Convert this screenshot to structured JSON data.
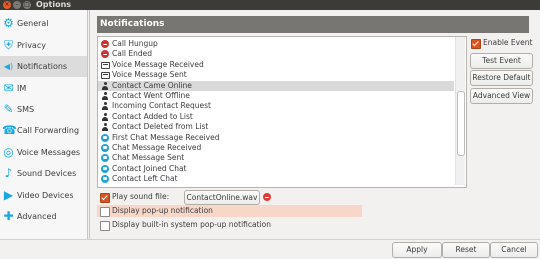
{
  "window": {
    "title": "Options",
    "close_glyph": "×",
    "min_glyph": "–",
    "max_glyph": "□"
  },
  "sidebar": {
    "items": [
      {
        "label": "General",
        "icon": "gear-icon",
        "glyph": "⚙"
      },
      {
        "label": "Privacy",
        "icon": "shield-icon",
        "glyph": "⛨"
      },
      {
        "label": "Notifications",
        "icon": "speaker-icon",
        "glyph": "◀)",
        "selected": true
      },
      {
        "label": "IM",
        "icon": "chat-icon",
        "glyph": "✉"
      },
      {
        "label": "SMS",
        "icon": "sms-icon",
        "glyph": "✎"
      },
      {
        "label": "Call Forwarding",
        "icon": "call-forward-icon",
        "glyph": "☎"
      },
      {
        "label": "Voice Messages",
        "icon": "voicemail-icon",
        "glyph": "◎"
      },
      {
        "label": "Sound Devices",
        "icon": "sound-icon",
        "glyph": "♪"
      },
      {
        "label": "Video Devices",
        "icon": "video-icon",
        "glyph": "▶"
      },
      {
        "label": "Advanced",
        "icon": "advanced-icon",
        "glyph": "✚"
      }
    ]
  },
  "notifications": {
    "header": "Notifications",
    "events": [
      {
        "label": "Call Hungup",
        "icon": "red"
      },
      {
        "label": "Call Ended",
        "icon": "red"
      },
      {
        "label": "Voice Message Received",
        "icon": "vm"
      },
      {
        "label": "Voice Message Sent",
        "icon": "vm"
      },
      {
        "label": "Contact Came Online",
        "icon": "person",
        "selected": true
      },
      {
        "label": "Contact Went Offline",
        "icon": "person"
      },
      {
        "label": "Incoming Contact Request",
        "icon": "person"
      },
      {
        "label": "Contact Added to List",
        "icon": "person"
      },
      {
        "label": "Contact Deleted from List",
        "icon": "person"
      },
      {
        "label": "First Chat Message Received",
        "icon": "cyan"
      },
      {
        "label": "Chat Message Received",
        "icon": "cyan"
      },
      {
        "label": "Chat Message Sent",
        "icon": "cyan"
      },
      {
        "label": "Contact Joined Chat",
        "icon": "cyan"
      },
      {
        "label": "Contact Left Chat",
        "icon": "cyan"
      }
    ],
    "enable_event_label": "Enable Event",
    "enable_event_checked": true,
    "test_event_label": "Test Event",
    "restore_default_label": "Restore Default",
    "advanced_view_label": "Advanced View",
    "play_sound_label": "Play sound file:",
    "play_sound_checked": true,
    "sound_file": "ContactOnline.wav",
    "display_popup_label": "Display pop-up notification",
    "display_popup_checked": false,
    "display_builtin_label": "Display built-in system pop-up notification",
    "display_builtin_checked": false
  },
  "footer": {
    "apply": "Apply",
    "reset": "Reset",
    "cancel": "Cancel"
  },
  "colors": {
    "accent": "#d9541e",
    "header_bg": "#777672",
    "icon_blue": "#19a9e0",
    "title_bar": "#3c3b37"
  }
}
